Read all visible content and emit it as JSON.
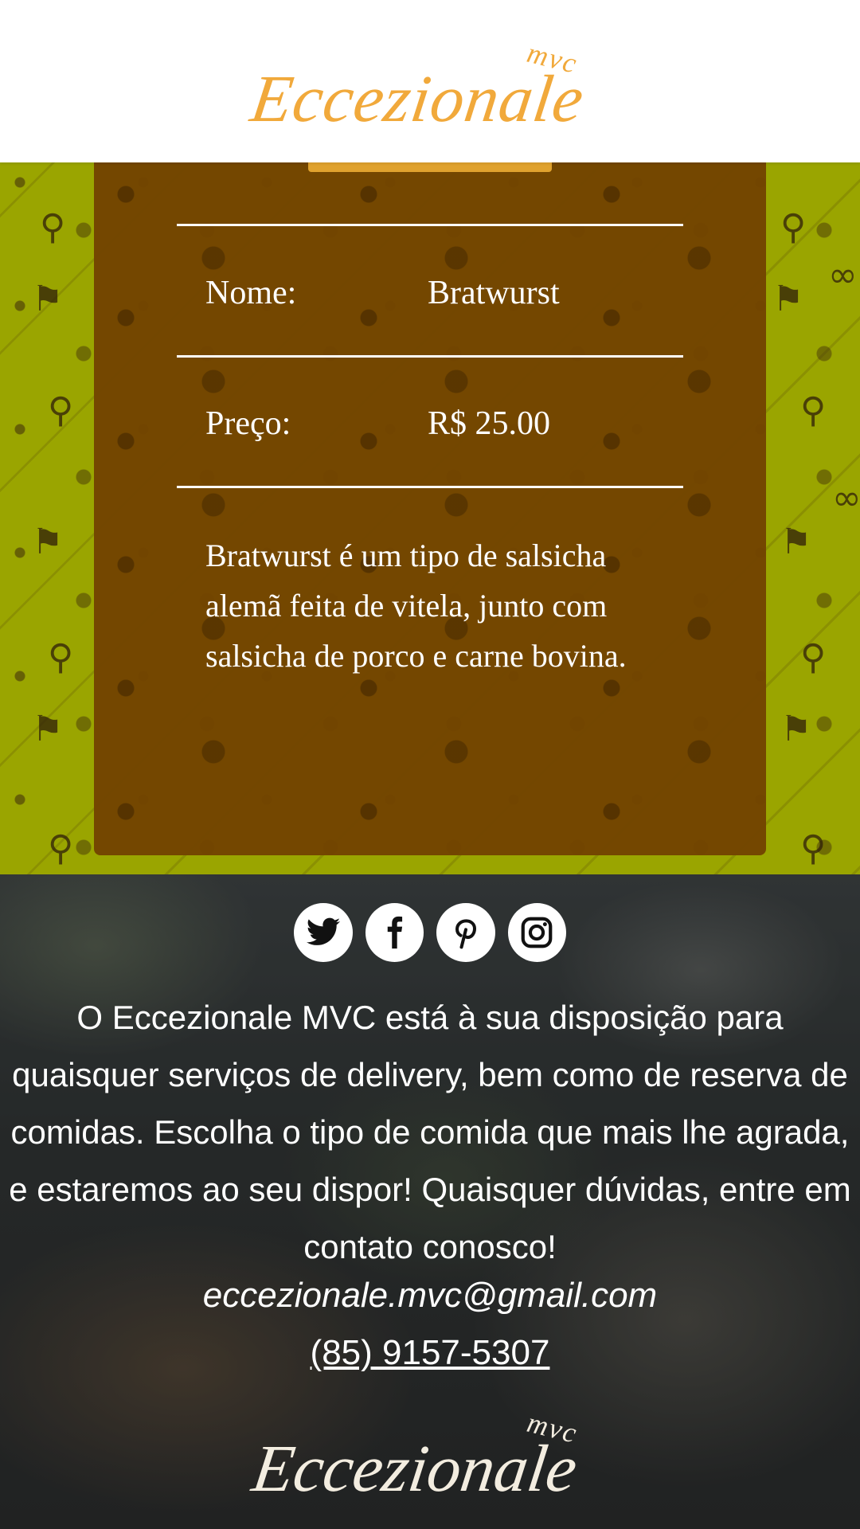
{
  "header": {
    "logo_text": "Eccezionale",
    "logo_sup": "mvc"
  },
  "product": {
    "name_label": "Nome:",
    "name_value": "Bratwurst",
    "price_label": "Preço:",
    "price_value": "R$ 25.00",
    "description": "Bratwurst é um tipo de salsicha alemã feita de vitela, junto com salsicha de porco e carne bovina."
  },
  "footer": {
    "social_icons": [
      "twitter-icon",
      "facebook-icon",
      "pinterest-icon",
      "instagram-icon"
    ],
    "text": "O Eccezionale MVC está à sua disposição para quaisquer serviços de delivery, bem como de reserva de comidas. Escolha o tipo de comida que mais lhe agrada, e estaremos ao seu dispor! Quaisquer dúvidas, entre em contato conosco!",
    "email": "eccezionale.mvc@gmail.com",
    "phone": "(85) 9157-5307",
    "logo_text": "Eccezionale",
    "logo_sup": "mvc"
  },
  "colors": {
    "brand": "#f1a93b",
    "pattern_bg": "#9aa500",
    "card_bg": "#734400",
    "card_tab": "#e0a22e"
  }
}
